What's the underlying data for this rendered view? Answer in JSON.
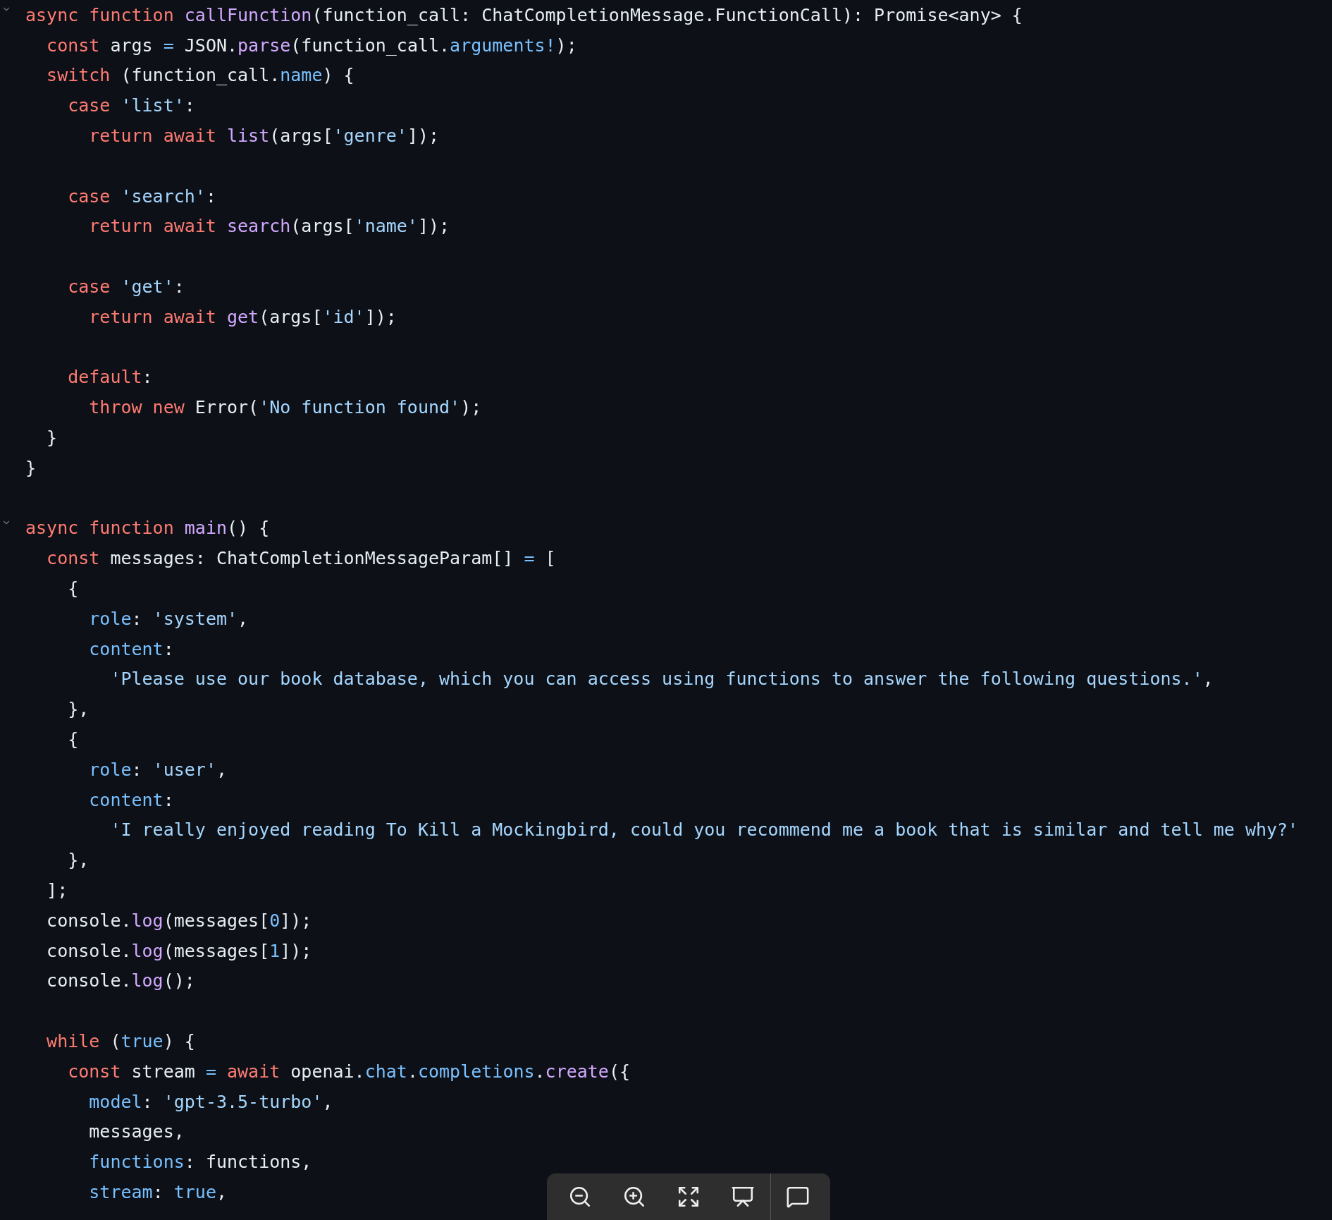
{
  "code": {
    "lines": [
      {
        "kind": "code",
        "fold": true,
        "tokens": [
          {
            "kind": "kw",
            "t": "async function "
          },
          {
            "kind": "fn",
            "t": "callFunction"
          },
          {
            "kind": "plain",
            "t": "(function_call: ChatCompletionMessage.FunctionCall): Promise<any> {"
          }
        ]
      },
      {
        "kind": "code",
        "tokens": [
          {
            "kind": "kw",
            "t": "  const"
          },
          {
            "kind": "plain",
            "t": " args "
          },
          {
            "kind": "prop",
            "t": "="
          },
          {
            "kind": "plain",
            "t": " JSON."
          },
          {
            "kind": "fn",
            "t": "parse"
          },
          {
            "kind": "plain",
            "t": "(function_call."
          },
          {
            "kind": "prop",
            "t": "arguments!"
          },
          {
            "kind": "plain",
            "t": ");"
          }
        ]
      },
      {
        "kind": "code",
        "tokens": [
          {
            "kind": "kw",
            "t": "  switch"
          },
          {
            "kind": "plain",
            "t": " (function_call."
          },
          {
            "kind": "prop",
            "t": "name"
          },
          {
            "kind": "plain",
            "t": ") {"
          }
        ]
      },
      {
        "kind": "code",
        "tokens": [
          {
            "kind": "kw",
            "t": "    case "
          },
          {
            "kind": "str",
            "t": "'list'"
          },
          {
            "kind": "plain",
            "t": ":"
          }
        ]
      },
      {
        "kind": "code",
        "tokens": [
          {
            "kind": "kw",
            "t": "      return await "
          },
          {
            "kind": "fn",
            "t": "list"
          },
          {
            "kind": "plain",
            "t": "(args["
          },
          {
            "kind": "str",
            "t": "'genre'"
          },
          {
            "kind": "plain",
            "t": "]);"
          }
        ]
      },
      {
        "kind": "blank"
      },
      {
        "kind": "code",
        "tokens": [
          {
            "kind": "kw",
            "t": "    case "
          },
          {
            "kind": "str",
            "t": "'search'"
          },
          {
            "kind": "plain",
            "t": ":"
          }
        ]
      },
      {
        "kind": "code",
        "tokens": [
          {
            "kind": "kw",
            "t": "      return await "
          },
          {
            "kind": "fn",
            "t": "search"
          },
          {
            "kind": "plain",
            "t": "(args["
          },
          {
            "kind": "str",
            "t": "'name'"
          },
          {
            "kind": "plain",
            "t": "]);"
          }
        ]
      },
      {
        "kind": "blank"
      },
      {
        "kind": "code",
        "tokens": [
          {
            "kind": "kw",
            "t": "    case "
          },
          {
            "kind": "str",
            "t": "'get'"
          },
          {
            "kind": "plain",
            "t": ":"
          }
        ]
      },
      {
        "kind": "code",
        "tokens": [
          {
            "kind": "kw",
            "t": "      return await "
          },
          {
            "kind": "fn",
            "t": "get"
          },
          {
            "kind": "plain",
            "t": "(args["
          },
          {
            "kind": "str",
            "t": "'id'"
          },
          {
            "kind": "plain",
            "t": "]);"
          }
        ]
      },
      {
        "kind": "blank"
      },
      {
        "kind": "code",
        "tokens": [
          {
            "kind": "kw",
            "t": "    default"
          },
          {
            "kind": "plain",
            "t": ":"
          }
        ]
      },
      {
        "kind": "code",
        "tokens": [
          {
            "kind": "kw",
            "t": "      throw new "
          },
          {
            "kind": "plain",
            "t": "Error("
          },
          {
            "kind": "str",
            "t": "'No function found'"
          },
          {
            "kind": "plain",
            "t": ");"
          }
        ]
      },
      {
        "kind": "code",
        "tokens": [
          {
            "kind": "plain",
            "t": "  }"
          }
        ]
      },
      {
        "kind": "code",
        "tokens": [
          {
            "kind": "plain",
            "t": "}"
          }
        ]
      },
      {
        "kind": "blank"
      },
      {
        "kind": "code",
        "fold": true,
        "tokens": [
          {
            "kind": "kw",
            "t": "async function "
          },
          {
            "kind": "fn",
            "t": "main"
          },
          {
            "kind": "plain",
            "t": "() {"
          }
        ]
      },
      {
        "kind": "code",
        "tokens": [
          {
            "kind": "kw",
            "t": "  const"
          },
          {
            "kind": "plain",
            "t": " messages: ChatCompletionMessageParam[] "
          },
          {
            "kind": "prop",
            "t": "="
          },
          {
            "kind": "plain",
            "t": " ["
          }
        ]
      },
      {
        "kind": "code",
        "tokens": [
          {
            "kind": "plain",
            "t": "    {"
          }
        ]
      },
      {
        "kind": "code",
        "tokens": [
          {
            "kind": "prop",
            "t": "      role"
          },
          {
            "kind": "plain",
            "t": ": "
          },
          {
            "kind": "str",
            "t": "'system'"
          },
          {
            "kind": "plain",
            "t": ","
          }
        ]
      },
      {
        "kind": "code",
        "tokens": [
          {
            "kind": "prop",
            "t": "      content"
          },
          {
            "kind": "plain",
            "t": ":"
          }
        ]
      },
      {
        "kind": "code",
        "tokens": [
          {
            "kind": "str",
            "t": "        'Please use our book database, which you can access using functions to answer the following questions.'"
          },
          {
            "kind": "plain",
            "t": ","
          }
        ]
      },
      {
        "kind": "code",
        "tokens": [
          {
            "kind": "plain",
            "t": "    },"
          }
        ]
      },
      {
        "kind": "code",
        "tokens": [
          {
            "kind": "plain",
            "t": "    {"
          }
        ]
      },
      {
        "kind": "code",
        "tokens": [
          {
            "kind": "prop",
            "t": "      role"
          },
          {
            "kind": "plain",
            "t": ": "
          },
          {
            "kind": "str",
            "t": "'user'"
          },
          {
            "kind": "plain",
            "t": ","
          }
        ]
      },
      {
        "kind": "code",
        "tokens": [
          {
            "kind": "prop",
            "t": "      content"
          },
          {
            "kind": "plain",
            "t": ":"
          }
        ]
      },
      {
        "kind": "code",
        "tokens": [
          {
            "kind": "str",
            "t": "        'I really enjoyed reading To Kill a Mockingbird, could you recommend me a book that is similar and tell me why?'"
          }
        ]
      },
      {
        "kind": "code",
        "tokens": [
          {
            "kind": "plain",
            "t": "    },"
          }
        ]
      },
      {
        "kind": "code",
        "tokens": [
          {
            "kind": "plain",
            "t": "  ];"
          }
        ]
      },
      {
        "kind": "code",
        "tokens": [
          {
            "kind": "plain",
            "t": "  console."
          },
          {
            "kind": "fn",
            "t": "log"
          },
          {
            "kind": "plain",
            "t": "(messages["
          },
          {
            "kind": "num",
            "t": "0"
          },
          {
            "kind": "plain",
            "t": "]);"
          }
        ]
      },
      {
        "kind": "code",
        "tokens": [
          {
            "kind": "plain",
            "t": "  console."
          },
          {
            "kind": "fn",
            "t": "log"
          },
          {
            "kind": "plain",
            "t": "(messages["
          },
          {
            "kind": "num",
            "t": "1"
          },
          {
            "kind": "plain",
            "t": "]);"
          }
        ]
      },
      {
        "kind": "code",
        "tokens": [
          {
            "kind": "plain",
            "t": "  console."
          },
          {
            "kind": "fn",
            "t": "log"
          },
          {
            "kind": "plain",
            "t": "();"
          }
        ]
      },
      {
        "kind": "blank"
      },
      {
        "kind": "code",
        "tokens": [
          {
            "kind": "kw",
            "t": "  while"
          },
          {
            "kind": "plain",
            "t": " ("
          },
          {
            "kind": "num",
            "t": "true"
          },
          {
            "kind": "plain",
            "t": ") {"
          }
        ]
      },
      {
        "kind": "code",
        "tokens": [
          {
            "kind": "kw",
            "t": "    const"
          },
          {
            "kind": "plain",
            "t": " stream "
          },
          {
            "kind": "prop",
            "t": "="
          },
          {
            "kind": "kw",
            "t": " await"
          },
          {
            "kind": "plain",
            "t": " openai."
          },
          {
            "kind": "prop",
            "t": "chat"
          },
          {
            "kind": "plain",
            "t": "."
          },
          {
            "kind": "prop",
            "t": "completions"
          },
          {
            "kind": "plain",
            "t": "."
          },
          {
            "kind": "fn",
            "t": "create"
          },
          {
            "kind": "plain",
            "t": "({"
          }
        ]
      },
      {
        "kind": "code",
        "tokens": [
          {
            "kind": "prop",
            "t": "      model"
          },
          {
            "kind": "plain",
            "t": ": "
          },
          {
            "kind": "str",
            "t": "'gpt-3.5-turbo'"
          },
          {
            "kind": "plain",
            "t": ","
          }
        ]
      },
      {
        "kind": "code",
        "tokens": [
          {
            "kind": "plain",
            "t": "      messages,"
          }
        ]
      },
      {
        "kind": "code",
        "tokens": [
          {
            "kind": "prop",
            "t": "      functions"
          },
          {
            "kind": "plain",
            "t": ": functions,"
          }
        ]
      },
      {
        "kind": "code",
        "tokens": [
          {
            "kind": "prop",
            "t": "      stream"
          },
          {
            "kind": "plain",
            "t": ": "
          },
          {
            "kind": "num",
            "t": "true"
          },
          {
            "kind": "plain",
            "t": ","
          }
        ]
      }
    ]
  },
  "viewer_toolbar": {
    "buttons": [
      {
        "kind": "zoom-out"
      },
      {
        "kind": "zoom-in"
      },
      {
        "kind": "fullscreen"
      },
      {
        "kind": "present"
      },
      {
        "kind": "comment"
      }
    ]
  }
}
